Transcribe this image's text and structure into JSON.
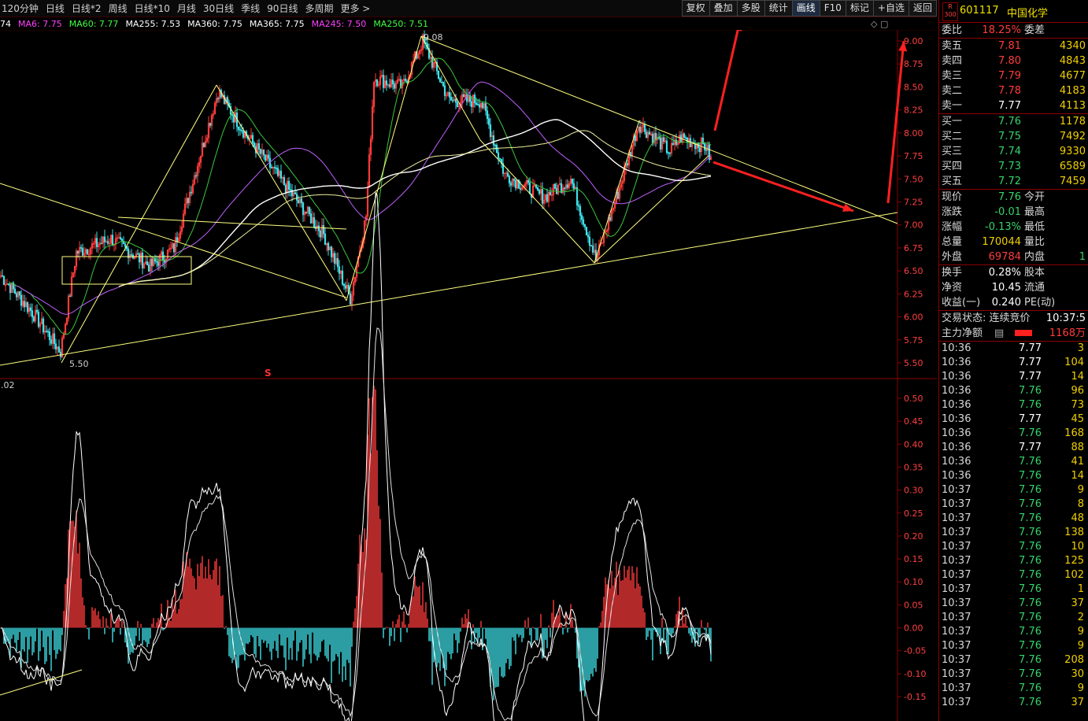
{
  "toolbar": {
    "periods": [
      "120分钟",
      "日线",
      "日线*2",
      "周线",
      "日线*10",
      "月线",
      "30日线",
      "季线",
      "90日线",
      "多周期",
      "更多 >"
    ],
    "buttons": [
      "复权",
      "叠加",
      "多股",
      "统计",
      "画线",
      "F10",
      "标记",
      "+自选",
      "返回"
    ]
  },
  "ma_legend": [
    {
      "label": "74",
      "color": "#ffffff"
    },
    {
      "label": "MA6: 7.75",
      "color": "#ff40ff"
    },
    {
      "label": "MA60: 7.77",
      "color": "#40ff40"
    },
    {
      "label": "MA255: 7.53",
      "color": "#ffffff"
    },
    {
      "label": "MA360: 7.75",
      "color": "#ffffff"
    },
    {
      "label": "MA365: 7.75",
      "color": "#ffffff"
    },
    {
      "label": "MA245: 7.50",
      "color": "#ff40ff"
    },
    {
      "label": "MA250: 7.51",
      "color": "#40ff40"
    }
  ],
  "top_icons": "◇ ▢",
  "price_axis": [
    "9.00",
    "8.75",
    "8.50",
    "8.25",
    "8.00",
    "7.75",
    "7.50",
    "7.25",
    "7.00",
    "6.75",
    "6.50",
    "6.25",
    "6.00",
    "5.75",
    "5.50"
  ],
  "osc_axis": [
    "0.50",
    "0.45",
    "0.40",
    "0.35",
    "0.30",
    "0.25",
    "0.20",
    "0.15",
    "0.10",
    "0.05",
    "0.00",
    "-0.05",
    "-0.10",
    "-0.15"
  ],
  "annotations": {
    "high": "9.08",
    "low": "5.50",
    "osc_label": ".02",
    "marker": "S"
  },
  "stock": {
    "badge_r": "R",
    "badge_n": "300",
    "code": "601117",
    "name": "中国化学"
  },
  "weibi": {
    "label": "委比",
    "value": "18.25%",
    "label2": "委差"
  },
  "asks": [
    {
      "label": "卖五",
      "price": "7.81",
      "vol": "4340",
      "cls": "red"
    },
    {
      "label": "卖四",
      "price": "7.80",
      "vol": "4843",
      "cls": "red"
    },
    {
      "label": "卖三",
      "price": "7.79",
      "vol": "4677",
      "cls": "red"
    },
    {
      "label": "卖二",
      "price": "7.78",
      "vol": "4183",
      "cls": "red"
    },
    {
      "label": "卖一",
      "price": "7.77",
      "vol": "4113",
      "cls": "wht"
    }
  ],
  "bids": [
    {
      "label": "买一",
      "price": "7.76",
      "vol": "1178"
    },
    {
      "label": "买二",
      "price": "7.75",
      "vol": "7492"
    },
    {
      "label": "买三",
      "price": "7.74",
      "vol": "9330"
    },
    {
      "label": "买四",
      "price": "7.73",
      "vol": "6589"
    },
    {
      "label": "买五",
      "price": "7.72",
      "vol": "7459"
    }
  ],
  "quote": [
    {
      "label": "现价",
      "value": "7.76",
      "cls": "green",
      "label2": "今开"
    },
    {
      "label": "涨跌",
      "value": "-0.01",
      "cls": "green",
      "label2": "最高"
    },
    {
      "label": "涨幅",
      "value": "-0.13%",
      "cls": "green",
      "label2": "最低"
    },
    {
      "label": "总量",
      "value": "170044",
      "cls": "yel",
      "label2": "量比"
    },
    {
      "label": "外盘",
      "value": "69784",
      "cls": "red",
      "label2": "内盘",
      "tail": "1"
    }
  ],
  "fund": [
    {
      "label": "换手",
      "value": "0.28%",
      "label2": "股本"
    },
    {
      "label": "净资",
      "value": "10.45",
      "label2": "流通"
    },
    {
      "label": "收益(一)",
      "value": "0.240",
      "label2": "PE(动)"
    }
  ],
  "trade_status": {
    "label": "交易状态: 连续竞价",
    "time": "10:37:5"
  },
  "main_net": {
    "label": "主力净额",
    "icon": "▤",
    "value": "1168万"
  },
  "ticks": [
    {
      "t": "10:36",
      "p": "7.77",
      "v": "3",
      "cls": "wht"
    },
    {
      "t": "10:36",
      "p": "7.77",
      "v": "104",
      "cls": "wht"
    },
    {
      "t": "10:36",
      "p": "7.77",
      "v": "14",
      "cls": "wht"
    },
    {
      "t": "10:36",
      "p": "7.76",
      "v": "96",
      "cls": "green"
    },
    {
      "t": "10:36",
      "p": "7.76",
      "v": "73",
      "cls": "green"
    },
    {
      "t": "10:36",
      "p": "7.77",
      "v": "45",
      "cls": "wht"
    },
    {
      "t": "10:36",
      "p": "7.76",
      "v": "168",
      "cls": "green"
    },
    {
      "t": "10:36",
      "p": "7.77",
      "v": "88",
      "cls": "wht"
    },
    {
      "t": "10:36",
      "p": "7.76",
      "v": "41",
      "cls": "green"
    },
    {
      "t": "10:36",
      "p": "7.76",
      "v": "14",
      "cls": "green"
    },
    {
      "t": "10:37",
      "p": "7.76",
      "v": "9",
      "cls": "green"
    },
    {
      "t": "10:37",
      "p": "7.76",
      "v": "8",
      "cls": "green"
    },
    {
      "t": "10:37",
      "p": "7.76",
      "v": "48",
      "cls": "green"
    },
    {
      "t": "10:37",
      "p": "7.76",
      "v": "138",
      "cls": "green"
    },
    {
      "t": "10:37",
      "p": "7.76",
      "v": "10",
      "cls": "green"
    },
    {
      "t": "10:37",
      "p": "7.76",
      "v": "125",
      "cls": "green"
    },
    {
      "t": "10:37",
      "p": "7.76",
      "v": "102",
      "cls": "green"
    },
    {
      "t": "10:37",
      "p": "7.76",
      "v": "1",
      "cls": "green"
    },
    {
      "t": "10:37",
      "p": "7.76",
      "v": "37",
      "cls": "green"
    },
    {
      "t": "10:37",
      "p": "7.76",
      "v": "2",
      "cls": "green"
    },
    {
      "t": "10:37",
      "p": "7.76",
      "v": "9",
      "cls": "green"
    },
    {
      "t": "10:37",
      "p": "7.76",
      "v": "9",
      "cls": "green"
    },
    {
      "t": "10:37",
      "p": "7.76",
      "v": "208",
      "cls": "green"
    },
    {
      "t": "10:37",
      "p": "7.76",
      "v": "30",
      "cls": "green"
    },
    {
      "t": "10:37",
      "p": "7.76",
      "v": "9",
      "cls": "green"
    },
    {
      "t": "10:37",
      "p": "7.76",
      "v": "37",
      "cls": "green"
    }
  ],
  "colors": {
    "up": "#ff3b3b",
    "down": "#3fe0e8",
    "ma_white": "#ffffff",
    "ma_green": "#3cc83c",
    "ma_purple": "#c060ff",
    "trend": "#ffff80",
    "border": "#8a0000"
  }
}
